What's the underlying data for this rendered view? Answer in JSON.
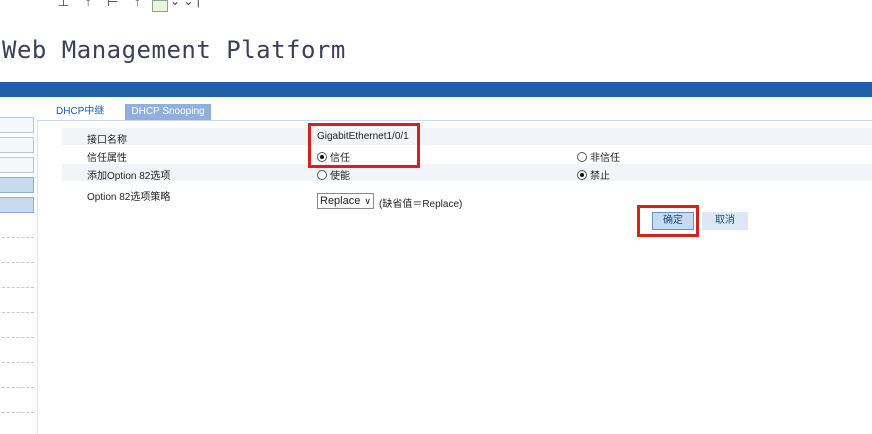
{
  "title": "Web Management Platform",
  "tabs": [
    {
      "label": "DHCP中继"
    },
    {
      "label": "DHCP Snooping"
    }
  ],
  "form": {
    "interface_label": "接口名称",
    "interface_value": "GigabitEthernet1/0/1",
    "trust_label": "信任属性",
    "trust_opt_trust": "信任",
    "trust_opt_untrust": "非信任",
    "trust_selected": "信任",
    "opt82_label": "添加Option 82选项",
    "opt82_enable": "使能",
    "opt82_disable": "禁止",
    "opt82_selected": "禁止",
    "strategy_label": "Option 82选项策略",
    "strategy_value": "Replace",
    "strategy_default_note": "(缺省值＝Replace)"
  },
  "buttons": {
    "ok": "确定",
    "cancel": "取消"
  },
  "colors": {
    "brand_band": "#1f5fa6",
    "active_tab_bg": "#8fb0dd",
    "highlight": "#d2231f"
  }
}
